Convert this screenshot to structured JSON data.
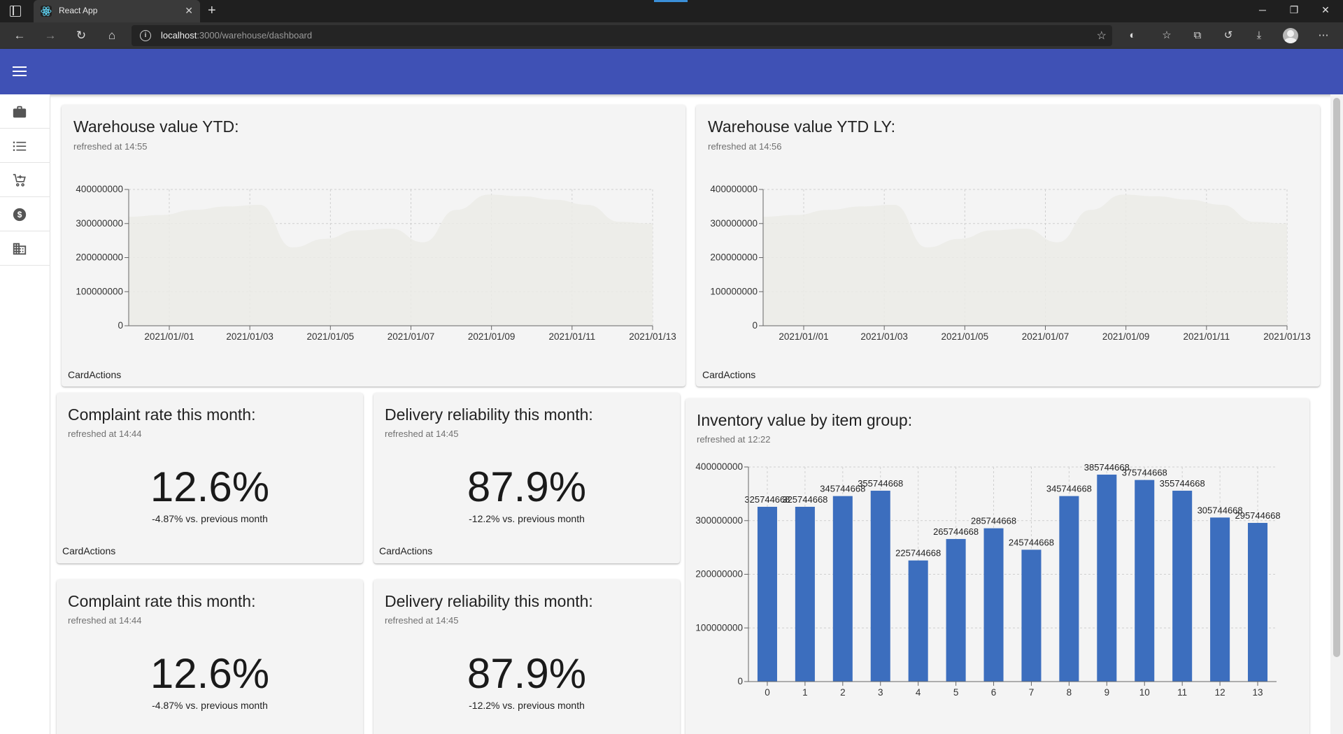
{
  "browser": {
    "tab_title": "React App",
    "url_host": "localhost",
    "url_path": ":3000/warehouse/dashboard"
  },
  "sidebar": {
    "items": [
      {
        "icon": "briefcase-icon"
      },
      {
        "icon": "list-icon"
      },
      {
        "icon": "cart-icon"
      },
      {
        "icon": "dollar-icon"
      },
      {
        "icon": "building-icon"
      }
    ]
  },
  "cards": {
    "ytd": {
      "title": "Warehouse value YTD:",
      "subtitle": "refreshed at 14:55",
      "actions": "CardActions"
    },
    "ytd_ly": {
      "title": "Warehouse value YTD LY:",
      "subtitle": "refreshed at 14:56",
      "actions": "CardActions"
    },
    "complaint_1": {
      "title": "Complaint rate this month:",
      "subtitle": "refreshed at 14:44",
      "value": "12.6%",
      "comparison": "-4.87% vs. previous month",
      "actions": "CardActions"
    },
    "delivery_1": {
      "title": "Delivery reliability this month:",
      "subtitle": "refreshed at 14:45",
      "value": "87.9%",
      "comparison": "-12.2% vs. previous month",
      "actions": "CardActions"
    },
    "complaint_2": {
      "title": "Complaint rate this month:",
      "subtitle": "refreshed at 14:44",
      "value": "12.6%",
      "comparison": "-4.87% vs. previous month"
    },
    "delivery_2": {
      "title": "Delivery reliability this month:",
      "subtitle": "refreshed at 14:45",
      "value": "87.9%",
      "comparison": "-12.2% vs. previous month"
    },
    "inventory": {
      "title": "Inventory value by item group:",
      "subtitle": "refreshed at 12:22"
    }
  },
  "colors": {
    "appbar": "#3f51b5",
    "bar_fill": "#3c6ebe",
    "area_fill": "#ebebe6"
  },
  "chart_data": [
    {
      "type": "area",
      "x": [
        "2021/01//01",
        "2021/01/03",
        "2021/01/05",
        "2021/01/07",
        "2021/01/09",
        "2021/01/11",
        "2021/01/13"
      ],
      "y_ticks": [
        "0",
        "100000000",
        "200000000",
        "300000000",
        "400000000"
      ],
      "ylim": [
        0,
        400000000
      ],
      "series": [
        {
          "values": [
            320000000,
            325000000,
            340000000,
            350000000,
            355000000,
            230000000,
            255000000,
            280000000,
            285000000,
            245000000,
            340000000,
            385000000,
            380000000,
            370000000,
            355000000,
            305000000,
            300000000
          ]
        }
      ],
      "grid": true
    },
    {
      "type": "area",
      "x": [
        "2021/01//01",
        "2021/01/03",
        "2021/01/05",
        "2021/01/07",
        "2021/01/09",
        "2021/01/11",
        "2021/01/13"
      ],
      "y_ticks": [
        "0",
        "100000000",
        "200000000",
        "300000000",
        "400000000"
      ],
      "ylim": [
        0,
        400000000
      ],
      "series": [
        {
          "values": [
            320000000,
            325000000,
            340000000,
            350000000,
            355000000,
            230000000,
            255000000,
            280000000,
            285000000,
            245000000,
            340000000,
            385000000,
            380000000,
            370000000,
            355000000,
            305000000,
            300000000
          ]
        }
      ],
      "grid": true
    },
    {
      "type": "bar",
      "categories": [
        "0",
        "1",
        "2",
        "3",
        "4",
        "5",
        "6",
        "7",
        "8",
        "9",
        "10",
        "11",
        "12",
        "13"
      ],
      "values": [
        325744668,
        325744668,
        345744668,
        355744668,
        225744668,
        265744668,
        285744668,
        245744668,
        345744668,
        385744668,
        375744668,
        355744668,
        305744668,
        295744668
      ],
      "value_labels": [
        "325744668",
        "325744668",
        "345744668",
        "355744668",
        "225744668",
        "265744668",
        "285744668",
        "245744668",
        "345744668",
        "385744668",
        "375744668",
        "355744668",
        "305744668",
        "295744668"
      ],
      "y_ticks": [
        "0",
        "100000000",
        "200000000",
        "300000000",
        "400000000"
      ],
      "ylim": [
        0,
        400000000
      ],
      "grid": true
    }
  ]
}
